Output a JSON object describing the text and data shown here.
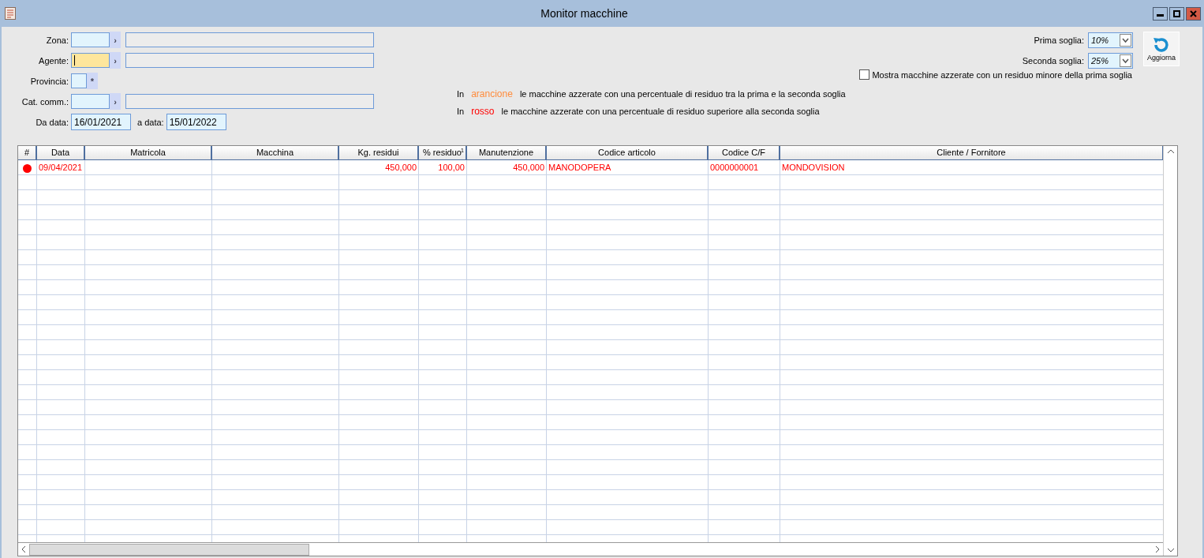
{
  "window": {
    "title": "Monitor macchine"
  },
  "filters": [
    {
      "kind": "lookup",
      "label": "Zona:",
      "focused": false,
      "button": "›"
    },
    {
      "kind": "lookup",
      "label": "Agente:",
      "focused": true,
      "button": "›"
    },
    {
      "kind": "short",
      "label": "Provincia:",
      "focused": false,
      "button": "*"
    },
    {
      "kind": "lookup",
      "label": "Cat. comm.:",
      "focused": false,
      "button": "›"
    }
  ],
  "dates": {
    "from_label": "Da data:",
    "from": "16/01/2021",
    "to_label": "a data:",
    "to": "15/01/2022"
  },
  "thresholds": [
    {
      "label": "Prima soglia:",
      "value": "10%"
    },
    {
      "label": "Seconda soglia:",
      "value": "25%"
    }
  ],
  "refresh_button": {
    "label": "Aggiorna"
  },
  "show_zeroed": {
    "label": "Mostra macchine azzerate con un residuo minore della prima soglia",
    "checked": false
  },
  "legend": [
    {
      "prefix": "In",
      "word": "arancione",
      "color": "#ff8c3c",
      "text": "le macchine azzerate con una percentuale di residuo tra la prima e la seconda soglia"
    },
    {
      "prefix": "In",
      "word": "rosso",
      "color": "#ff0000",
      "text": "le macchine azzerate con una percentuale di residuo superiore alla seconda soglia"
    }
  ],
  "table": {
    "columns": [
      {
        "label": "#"
      },
      {
        "label": "Data"
      },
      {
        "label": "Matricola"
      },
      {
        "label": "Macchina"
      },
      {
        "label": "Kg. residui"
      },
      {
        "label": "% residuo",
        "sort_order": "1"
      },
      {
        "label": "Manutenzione"
      },
      {
        "label": "Codice articolo"
      },
      {
        "label": "Codice C/F"
      },
      {
        "label": "Cliente / Fornitore"
      }
    ],
    "rows": [
      {
        "color": "#ff0000",
        "cells": [
          "",
          "09/04/2021",
          "",
          "",
          "450,000",
          "100,00",
          "450,000",
          "MANODOPERA",
          "0000000001",
          "MONDOVISION"
        ]
      }
    ]
  }
}
